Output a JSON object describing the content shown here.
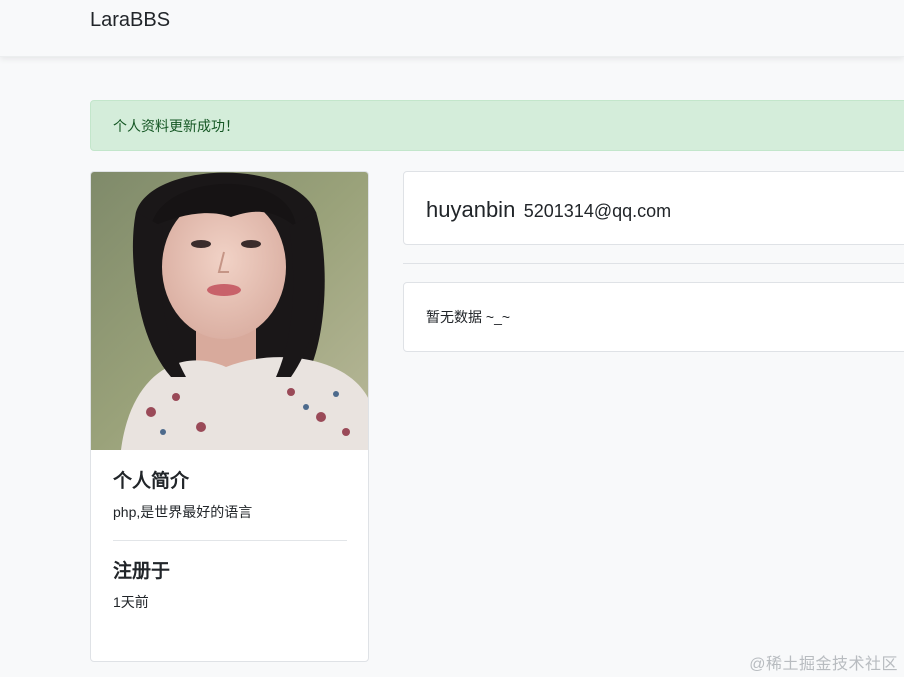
{
  "navbar": {
    "brand": "LaraBBS"
  },
  "alert": {
    "message": "个人资料更新成功！",
    "color": "#d4edda"
  },
  "profile": {
    "avatar_alt": "user-avatar-photo",
    "intro_title": "个人简介",
    "intro_text": "php,是世界最好的语言",
    "registered_title": "注册于",
    "registered_text": "1天前"
  },
  "user": {
    "name": "huyanbin",
    "email": "5201314@qq.com"
  },
  "content": {
    "empty_text": "暂无数据 ~_~"
  },
  "watermark": {
    "text": "@稀土掘金技术社区"
  }
}
